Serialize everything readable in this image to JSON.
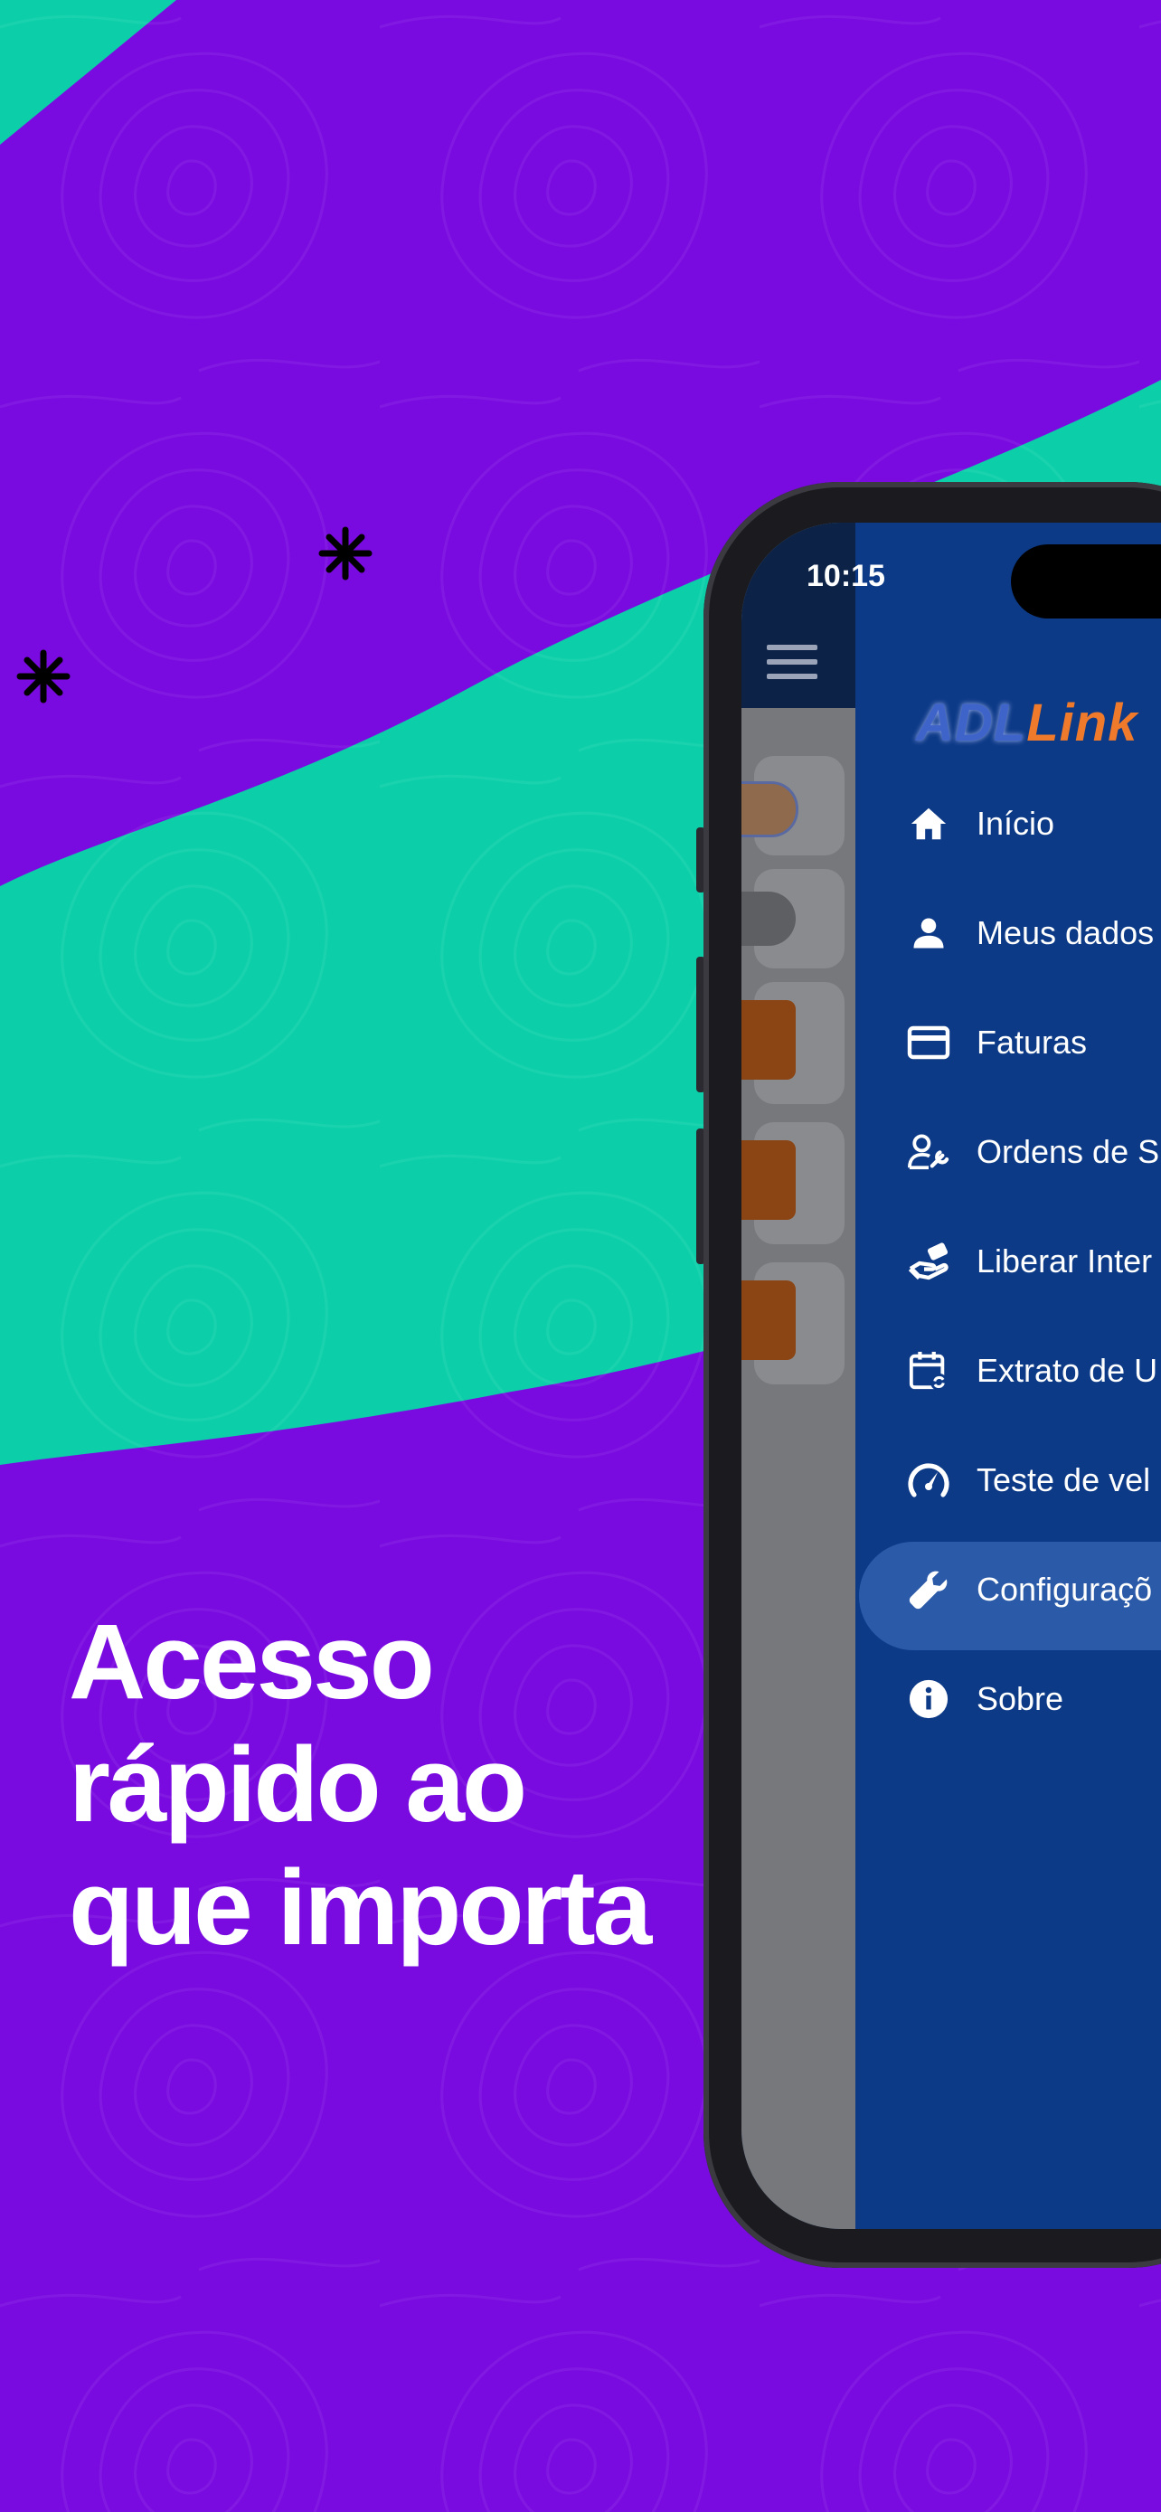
{
  "headline": {
    "line1": "Acesso",
    "line2": "rápido ao",
    "line3": "que importa"
  },
  "phone": {
    "status_time": "10:15",
    "logo": {
      "part1": "ADL",
      "part2": "Link"
    },
    "menu": [
      {
        "label": "Início",
        "icon": "home-icon"
      },
      {
        "label": "Meus dados",
        "icon": "user-icon"
      },
      {
        "label": "Faturas",
        "icon": "credit-card-icon"
      },
      {
        "label": "Ordens de S",
        "icon": "user-wrench-icon"
      },
      {
        "label": "Liberar Inter",
        "icon": "hand-money-icon"
      },
      {
        "label": "Extrato de U",
        "icon": "calendar-sync-icon"
      },
      {
        "label": "Teste de vel",
        "icon": "speedometer-icon"
      },
      {
        "label": "Configuraçõ",
        "icon": "wrench-icon",
        "active": true
      },
      {
        "label": "Sobre",
        "icon": "info-icon"
      }
    ]
  },
  "colors": {
    "background_purple": "#7a0be0",
    "band_teal": "#0ccfa9",
    "drawer_blue": "#0d3a87",
    "active_item": "#2b5aa8",
    "logo_orange": "#f07a2b"
  }
}
